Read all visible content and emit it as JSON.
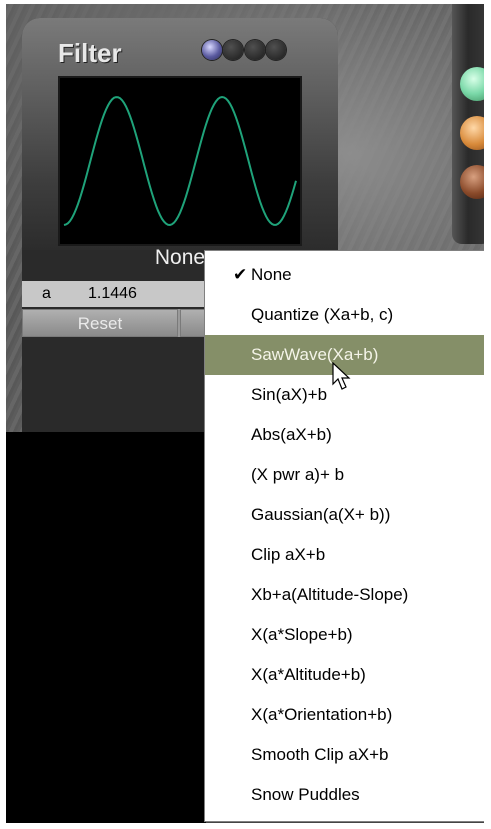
{
  "filter_panel": {
    "title": "Filter",
    "current_filter": "None",
    "param_name": "a",
    "param_value": "1.1446",
    "reset_label": "Reset"
  },
  "menu": {
    "checked_index": 0,
    "highlighted_index": 2,
    "items": [
      "None",
      "Quantize (Xa+b, c)",
      "SawWave(Xa+b)",
      "Sin(aX)+b",
      "Abs(aX+b)",
      "(X pwr a)+ b",
      "Gaussian(a(X+ b))",
      "Clip aX+b",
      "Xb+a(Altitude-Slope)",
      "X(a*Slope+b)",
      "X(a*Altitude+b)",
      "X(a*Orientation+b)",
      "Smooth Clip aX+b",
      "Snow Puddles"
    ]
  },
  "colors": {
    "wave": "#1fa37a",
    "highlight": "#858f68",
    "light_green": "#7ad8a8",
    "light_orange": "#d88a3a",
    "light_brown": "#8a4a2a"
  }
}
